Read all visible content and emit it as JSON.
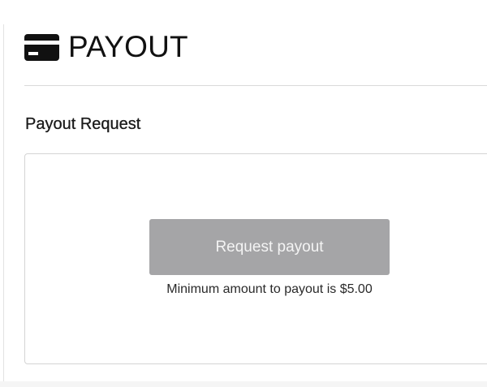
{
  "header": {
    "icon": "credit-card-icon",
    "title": "PAYOUT"
  },
  "section": {
    "title": "Payout Request"
  },
  "payout": {
    "button_label": "Request payout",
    "button_state": "disabled",
    "min_note": "Minimum amount to payout is $5.00"
  },
  "colors": {
    "button_bg": "#a5a5a7",
    "button_text": "#f4f4f4",
    "border": "#d4d4d4"
  }
}
